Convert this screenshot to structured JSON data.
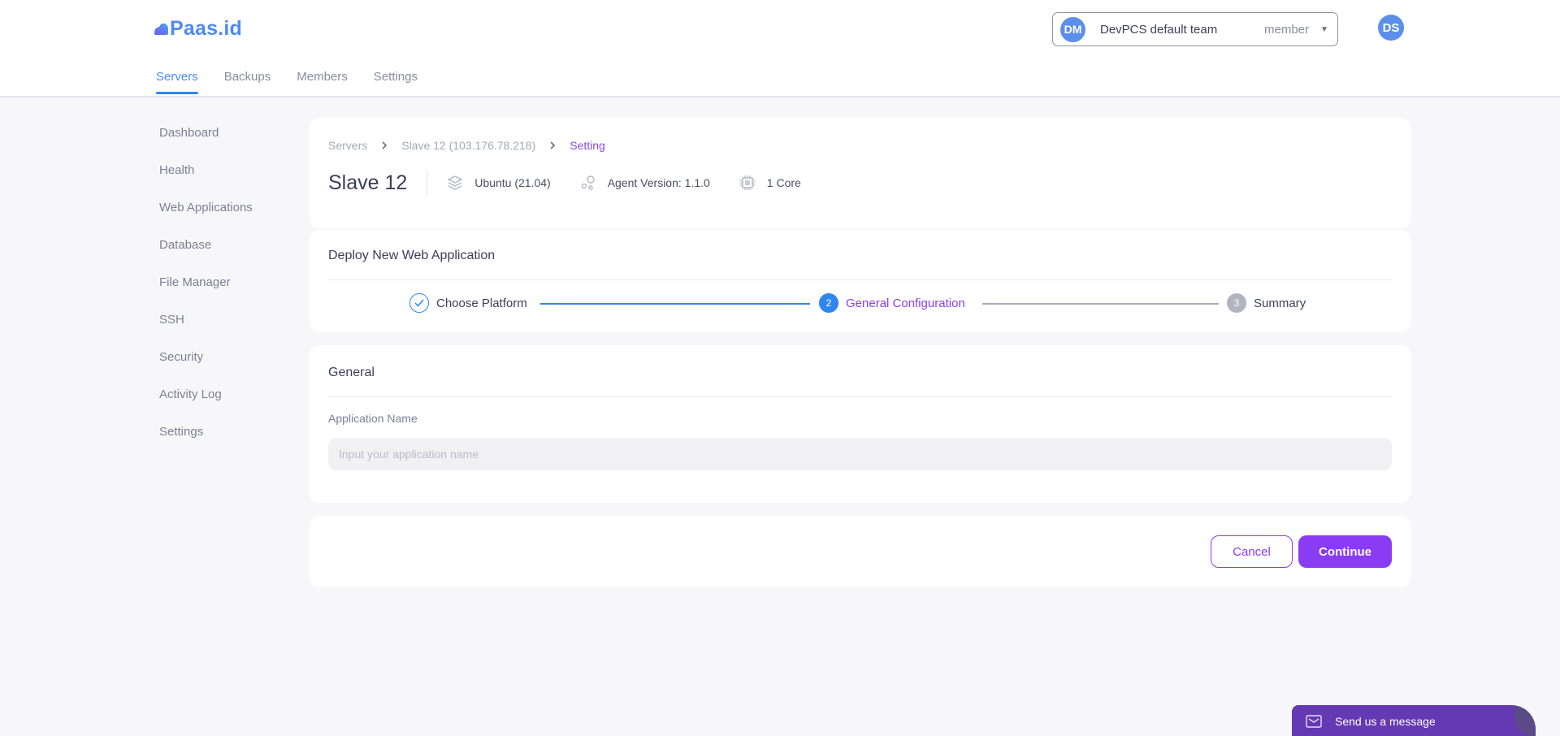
{
  "header": {
    "logo_text": "Paas.id",
    "tabs": [
      {
        "label": "Servers",
        "active": true
      },
      {
        "label": "Backups",
        "active": false
      },
      {
        "label": "Members",
        "active": false
      },
      {
        "label": "Settings",
        "active": false
      }
    ],
    "team": {
      "initials": "DM",
      "name": "DevPCS default team",
      "role": "member"
    },
    "user_initials": "DS"
  },
  "sidebar": {
    "items": [
      {
        "label": "Dashboard"
      },
      {
        "label": "Health"
      },
      {
        "label": "Web Applications"
      },
      {
        "label": "Database"
      },
      {
        "label": "File Manager"
      },
      {
        "label": "SSH"
      },
      {
        "label": "Security"
      },
      {
        "label": "Activity Log"
      },
      {
        "label": "Settings"
      }
    ]
  },
  "breadcrumb": [
    {
      "label": "Servers"
    },
    {
      "label": "Slave 12 (103.176.78.218)"
    },
    {
      "label": "Setting"
    }
  ],
  "server": {
    "name": "Slave 12",
    "os": "Ubuntu (21.04)",
    "agent_version": "Agent Version: 1.1.0",
    "cores": "1 Core",
    "icons": [
      "layers-icon",
      "agent-icon",
      "cpu-icon"
    ]
  },
  "deploy": {
    "title": "Deploy New Web Application",
    "steps": [
      {
        "number": "1",
        "label": "Choose Platform",
        "state": "done"
      },
      {
        "number": "2",
        "label": "General Configuration",
        "state": "active"
      },
      {
        "number": "3",
        "label": "Summary",
        "state": "pending"
      }
    ]
  },
  "general": {
    "title": "General",
    "app_name_label": "Application Name",
    "app_name_value": "",
    "app_name_placeholder": "Input your application name"
  },
  "actions": {
    "cancel_label": "Cancel",
    "continue_label": "Continue"
  },
  "chat_widget": {
    "label": "Send us a message"
  },
  "colors": {
    "primary_blue": "#2f86f0",
    "accent_purple": "#8a3cf2",
    "chat_purple": "#6539b3",
    "avatar_blue": "#5b8fea"
  }
}
